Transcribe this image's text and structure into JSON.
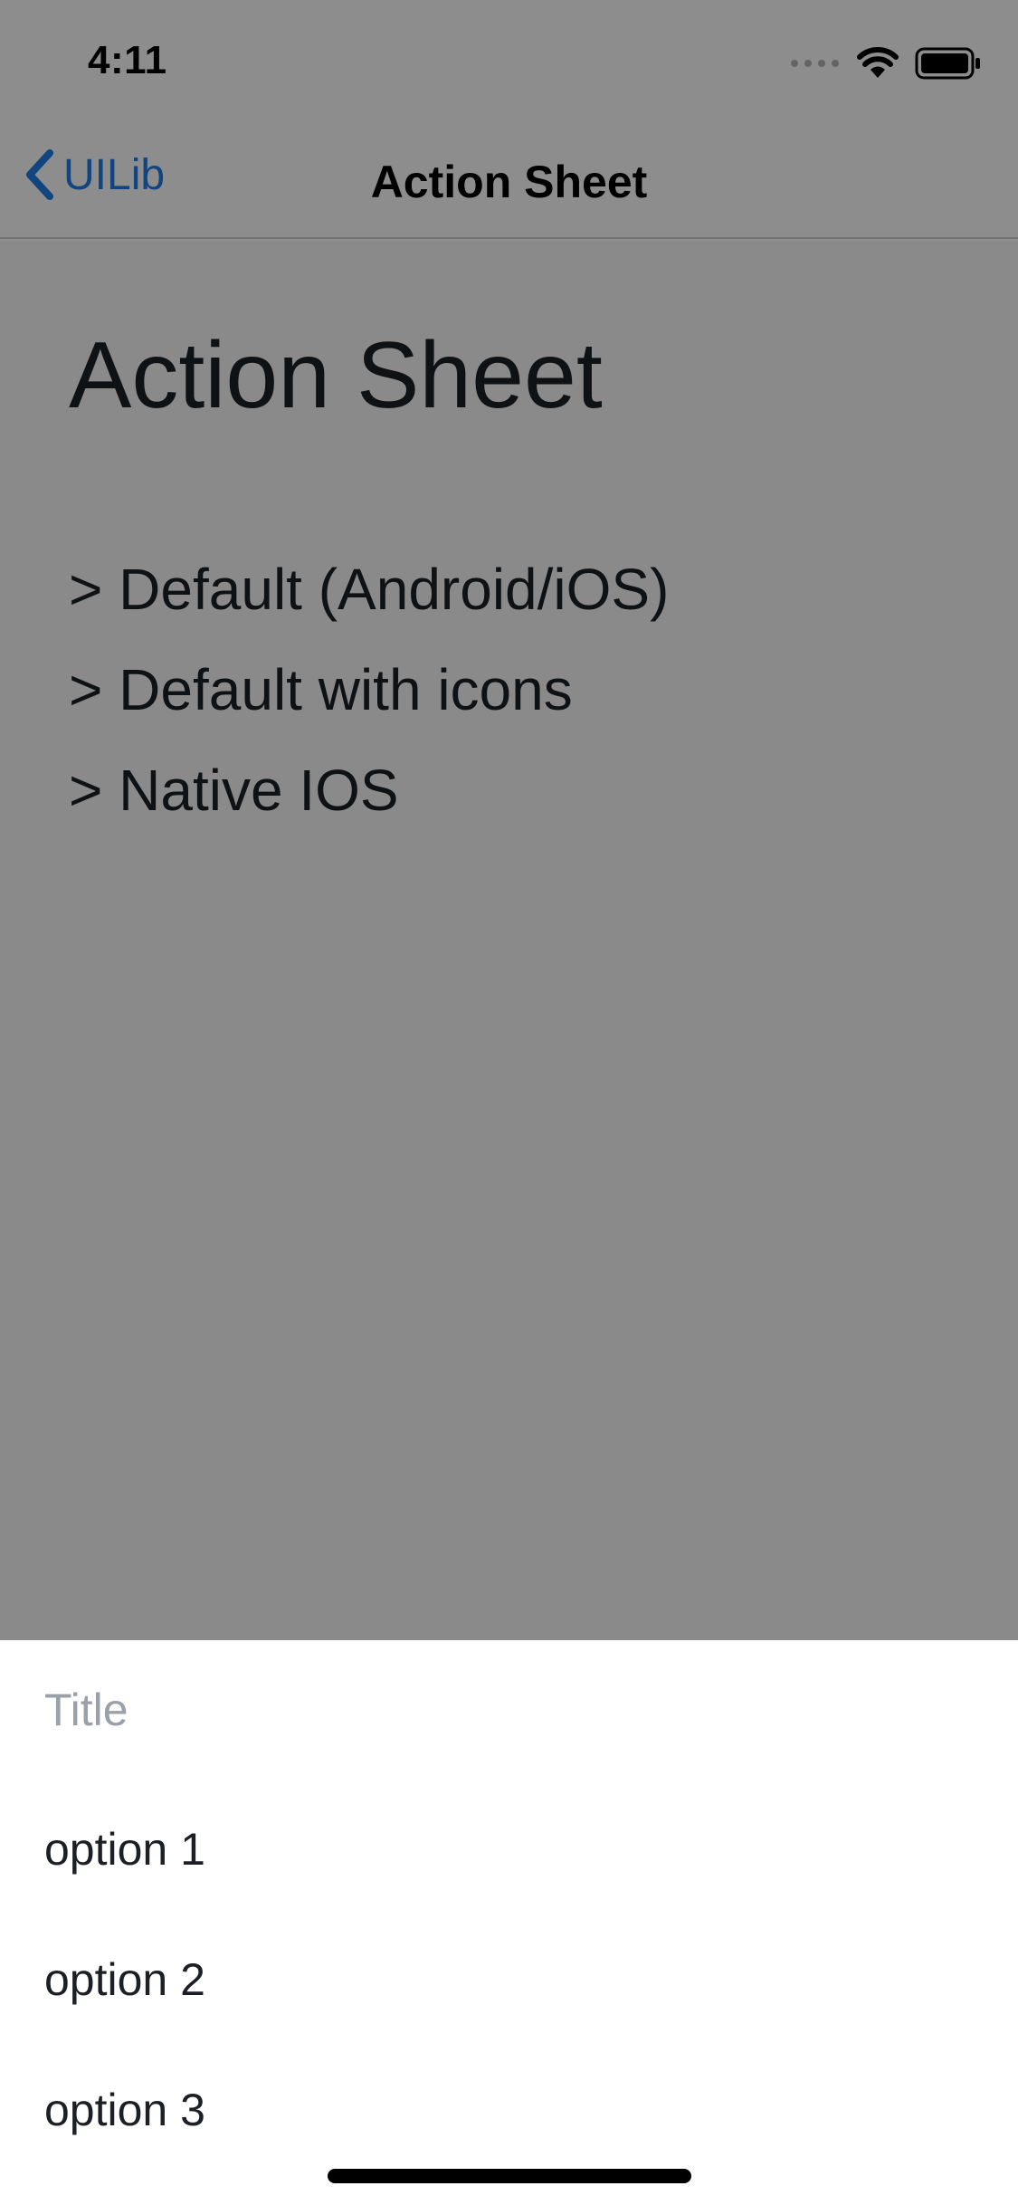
{
  "status_bar": {
    "time": "4:11"
  },
  "navbar": {
    "back_label": "UILib",
    "title": "Action Sheet"
  },
  "page": {
    "heading": "Action Sheet",
    "links": [
      "> Default (Android/iOS)",
      "> Default with icons",
      "> Native IOS"
    ]
  },
  "action_sheet": {
    "title": "Title",
    "options": [
      "option 1",
      "option 2",
      "option 3"
    ]
  },
  "colors": {
    "accent": "#1f7ae0",
    "text": "#1c2026",
    "muted": "#9aa0a8",
    "overlay": "rgba(0,0,0,0.43)"
  }
}
